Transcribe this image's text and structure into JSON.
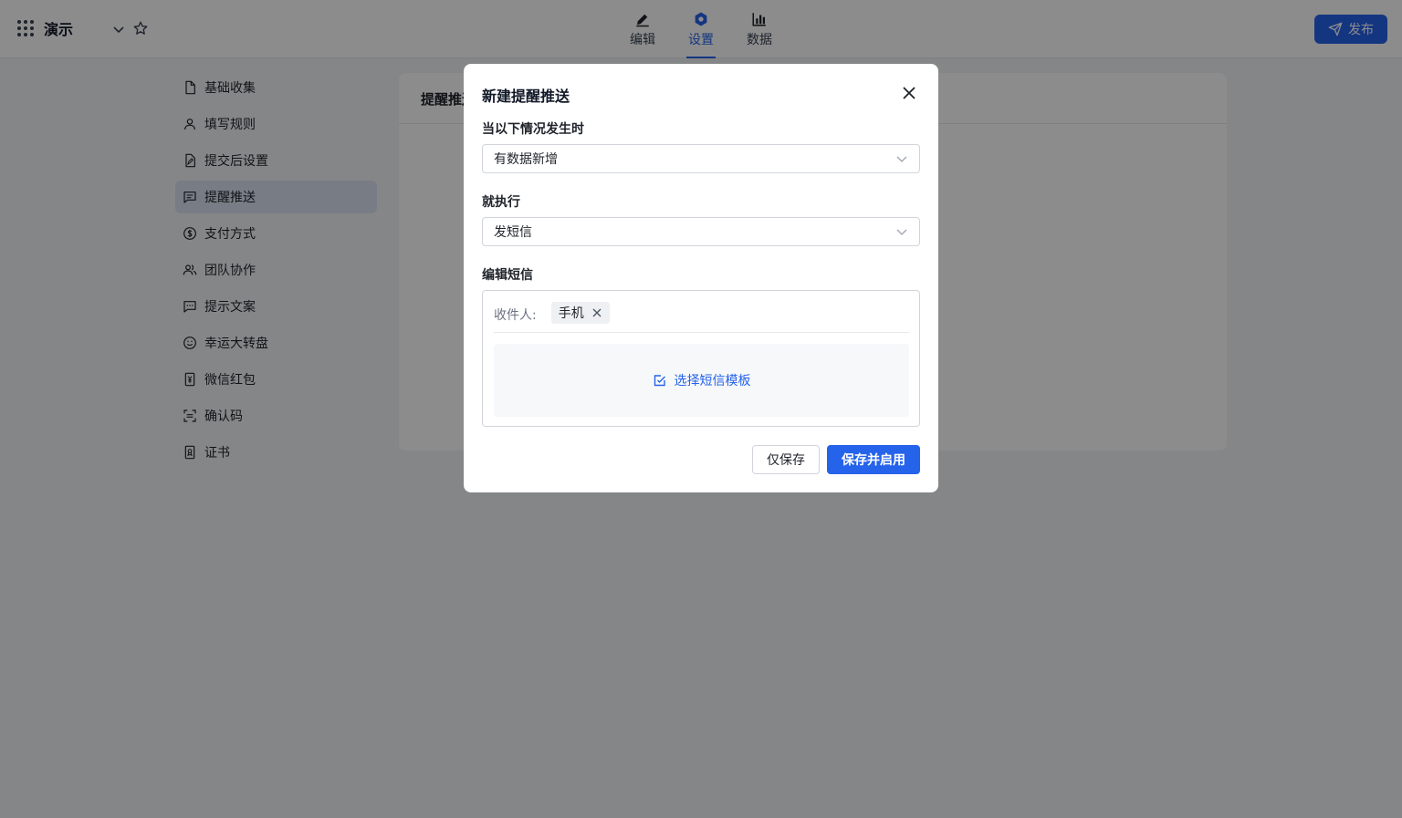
{
  "header": {
    "app_title": "演示",
    "tabs": [
      {
        "label": "编辑",
        "icon": "pencil-icon"
      },
      {
        "label": "设置",
        "icon": "settings-icon"
      },
      {
        "label": "数据",
        "icon": "bar-chart-icon"
      }
    ],
    "active_tab": "设置",
    "publish_label": "发布"
  },
  "sidebar": {
    "items": [
      {
        "label": "基础收集",
        "icon": "file-icon"
      },
      {
        "label": "填写规则",
        "icon": "user-icon"
      },
      {
        "label": "提交后设置",
        "icon": "file-edit-icon"
      },
      {
        "label": "提醒推送",
        "icon": "message-icon"
      },
      {
        "label": "支付方式",
        "icon": "dollar-icon"
      },
      {
        "label": "团队协作",
        "icon": "users-icon"
      },
      {
        "label": "提示文案",
        "icon": "chat-icon"
      },
      {
        "label": "幸运大转盘",
        "icon": "smile-icon"
      },
      {
        "label": "微信红包",
        "icon": "red-envelope-icon"
      },
      {
        "label": "确认码",
        "icon": "scan-icon"
      },
      {
        "label": "证书",
        "icon": "certificate-icon"
      }
    ],
    "active": "提醒推送"
  },
  "content": {
    "card_title": "提醒推送"
  },
  "modal": {
    "title": "新建提醒推送",
    "trigger_label": "当以下情况发生时",
    "trigger_value": "有数据新增",
    "action_label": "就执行",
    "action_value": "发短信",
    "sms_label": "编辑短信",
    "recipient_label": "收件人:",
    "recipient_tag": "手机",
    "template_link": "选择短信模板",
    "save_only": "仅保存",
    "save_enable": "保存并启用"
  },
  "colors": {
    "accent": "#2563eb",
    "active_sidebar_bg": "#dbe4f3"
  }
}
